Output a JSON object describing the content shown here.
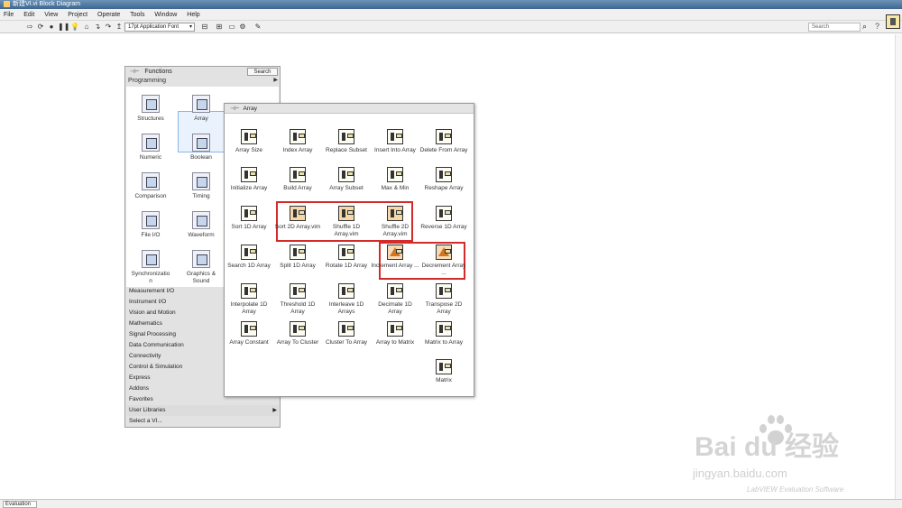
{
  "window": {
    "title": "新建VI.vi Block Diagram"
  },
  "menu": [
    "File",
    "Edit",
    "View",
    "Project",
    "Operate",
    "Tools",
    "Window",
    "Help"
  ],
  "toolbar": {
    "font_selector": "17pt Application Font",
    "search_placeholder": "Search"
  },
  "functions_palette": {
    "title": "Functions",
    "search_button": "Search",
    "category": "Programming",
    "grid": [
      {
        "label": "Structures",
        "icon": "structures-icon"
      },
      {
        "label": "Array",
        "icon": "array-icon",
        "selected": true
      },
      {
        "label": "Numeric",
        "icon": "numeric-icon"
      },
      {
        "label": "Boolean",
        "icon": "boolean-icon"
      },
      {
        "label": "Comparison",
        "icon": "comparison-icon"
      },
      {
        "label": "Timing",
        "icon": "timing-icon"
      },
      {
        "label": "File I/O",
        "icon": "file-io-icon"
      },
      {
        "label": "Waveform",
        "icon": "waveform-icon"
      },
      {
        "label": "Synchronizatio n",
        "icon": "synchronization-icon"
      },
      {
        "label": "Graphics & Sound",
        "icon": "graphics-sound-icon"
      }
    ],
    "list": [
      "Measurement I/O",
      "Instrument I/O",
      "Vision and Motion",
      "Mathematics",
      "Signal Processing",
      "Data Communication",
      "Connectivity",
      "Control & Simulation",
      "Express",
      "Addons",
      "Favorites",
      "User Libraries",
      "Select a VI..."
    ]
  },
  "array_palette": {
    "title": "Array",
    "items": [
      {
        "label": "Array Size",
        "icon": "array-size-icon"
      },
      {
        "label": "Index Array",
        "icon": "index-array-icon"
      },
      {
        "label": "Replace Subset",
        "icon": "replace-subset-icon"
      },
      {
        "label": "Insert Into Array",
        "icon": "insert-into-array-icon"
      },
      {
        "label": "Delete From Array",
        "icon": "delete-from-array-icon"
      },
      {
        "label": "Initialize Array",
        "icon": "initialize-array-icon"
      },
      {
        "label": "Build Array",
        "icon": "build-array-icon"
      },
      {
        "label": "Array Subset",
        "icon": "array-subset-icon"
      },
      {
        "label": "Max & Min",
        "icon": "max-min-icon"
      },
      {
        "label": "Reshape Array",
        "icon": "reshape-array-icon"
      },
      {
        "label": "Sort 1D Array",
        "icon": "sort-1d-array-icon"
      },
      {
        "label": "Sort 2D Array.vim",
        "icon": "sort-2d-array-icon"
      },
      {
        "label": "Shuffle 1D Array.vim",
        "icon": "shuffle-1d-array-icon"
      },
      {
        "label": "Shuffle 2D Array.vim",
        "icon": "shuffle-2d-array-icon"
      },
      {
        "label": "Reverse 1D Array",
        "icon": "reverse-1d-array-icon"
      },
      {
        "label": "Search 1D Array",
        "icon": "search-1d-array-icon"
      },
      {
        "label": "Split 1D Array",
        "icon": "split-1d-array-icon"
      },
      {
        "label": "Rotate 1D Array",
        "icon": "rotate-1d-array-icon"
      },
      {
        "label": "Increment Array ...",
        "icon": "increment-array-icon"
      },
      {
        "label": "Decrement Array ...",
        "icon": "decrement-array-icon"
      },
      {
        "label": "Interpolate 1D Array",
        "icon": "interpolate-1d-array-icon"
      },
      {
        "label": "Threshold 1D Array",
        "icon": "threshold-1d-array-icon"
      },
      {
        "label": "Interleave 1D Arrays",
        "icon": "interleave-1d-arrays-icon"
      },
      {
        "label": "Decimate 1D Array",
        "icon": "decimate-1d-array-icon"
      },
      {
        "label": "Transpose 2D Array",
        "icon": "transpose-2d-array-icon"
      },
      {
        "label": "Array Constant",
        "icon": "array-constant-icon"
      },
      {
        "label": "Array To Cluster",
        "icon": "array-to-cluster-icon"
      },
      {
        "label": "Cluster To Array",
        "icon": "cluster-to-array-icon"
      },
      {
        "label": "Array to Matrix",
        "icon": "array-to-matrix-icon"
      },
      {
        "label": "Matrix to Array",
        "icon": "matrix-to-array-icon"
      },
      {
        "label": "Matrix",
        "icon": "matrix-icon"
      }
    ]
  },
  "status": {
    "label": "Evaluation"
  },
  "watermark": {
    "logo": "Bai du 经验",
    "url": "jingyan.baidu.com",
    "software": "LabVIEW Evaluation Software"
  },
  "colors": {
    "highlight": "#d42a2a",
    "selection": "#8ab6e8"
  }
}
